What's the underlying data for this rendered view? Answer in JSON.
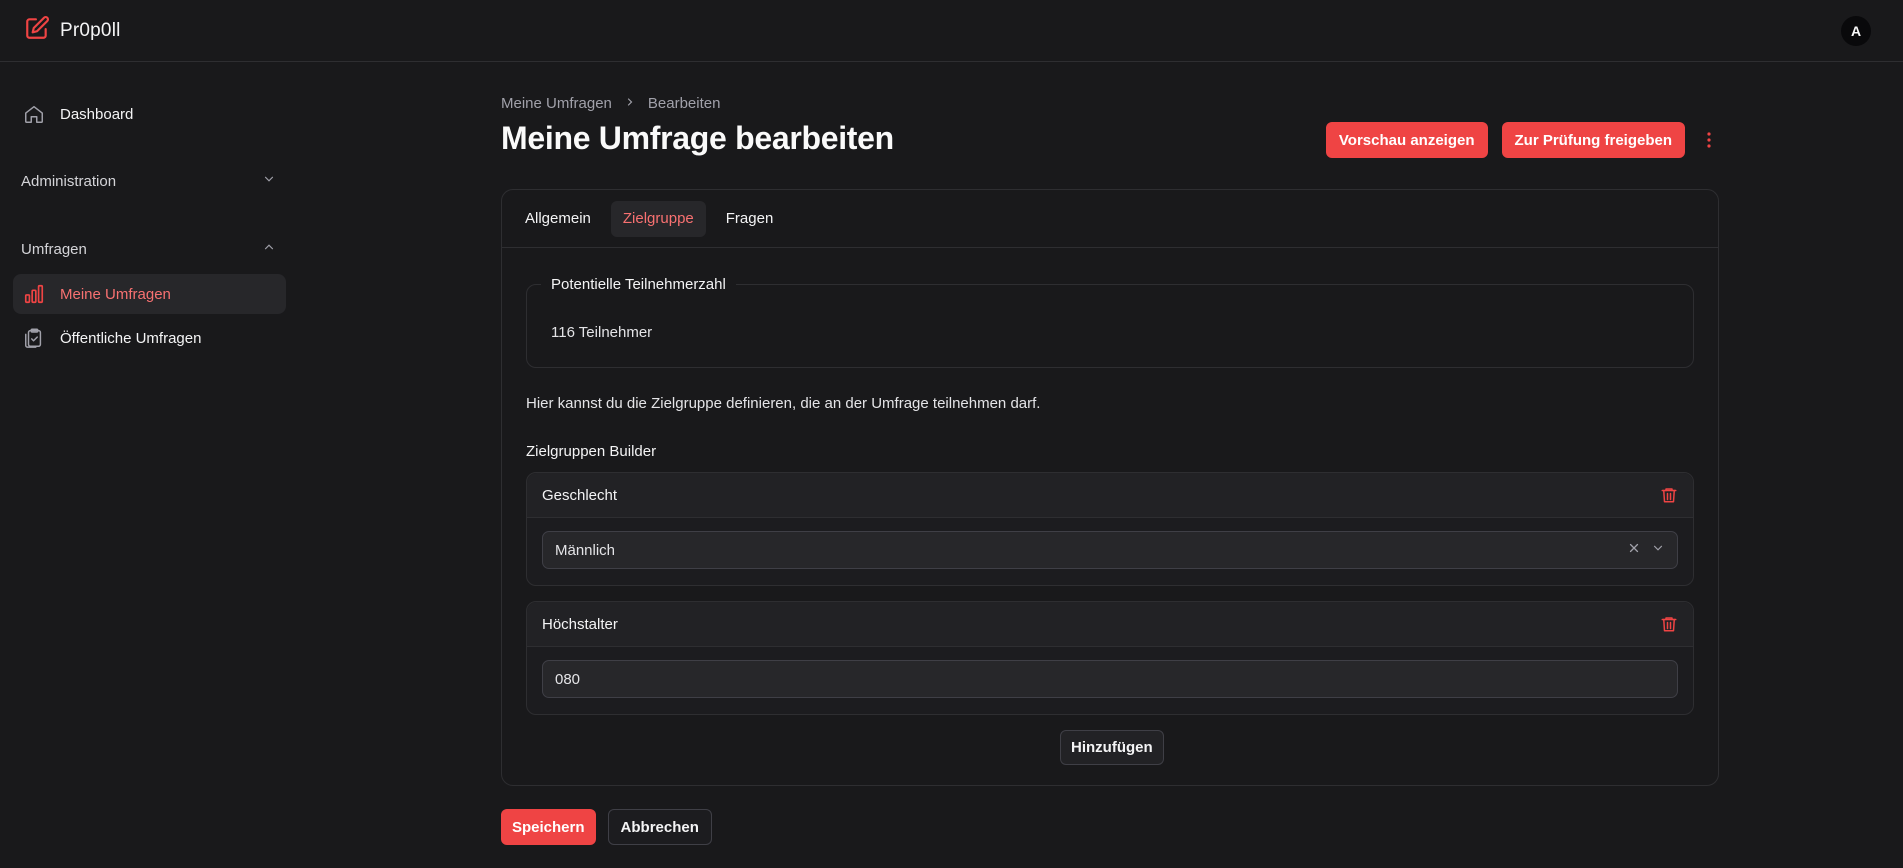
{
  "app": {
    "name": "Pr0p0ll",
    "user_initial": "A"
  },
  "sidebar": {
    "dashboard": "Dashboard",
    "administration": "Administration",
    "umfragen": "Umfragen",
    "meine_umfragen": "Meine Umfragen",
    "oeffentliche_umfragen": "Öffentliche Umfragen"
  },
  "breadcrumb": {
    "parent": "Meine Umfragen",
    "current": "Bearbeiten"
  },
  "page": {
    "title": "Meine Umfrage bearbeiten"
  },
  "actions": {
    "preview": "Vorschau anzeigen",
    "submit": "Zur Prüfung freigeben"
  },
  "tabs": [
    "Allgemein",
    "Zielgruppe",
    "Fragen"
  ],
  "participants": {
    "legend": "Potentielle Teilnehmerzahl",
    "value": "116 Teilnehmer"
  },
  "description": "Hier kannst du die Zielgruppe definieren, die an der Umfrage teilnehmen darf.",
  "builder": {
    "label": "Zielgruppen Builder",
    "criteria": [
      {
        "title": "Geschlecht",
        "value": "Männlich"
      },
      {
        "title": "Höchstalter",
        "value": "080"
      }
    ],
    "add_label": "Hinzufügen"
  },
  "footer": {
    "save": "Speichern",
    "cancel": "Abbrechen"
  },
  "colors": {
    "accent": "#ef4444",
    "accent_text": "#f87171",
    "background": "#19191b"
  }
}
